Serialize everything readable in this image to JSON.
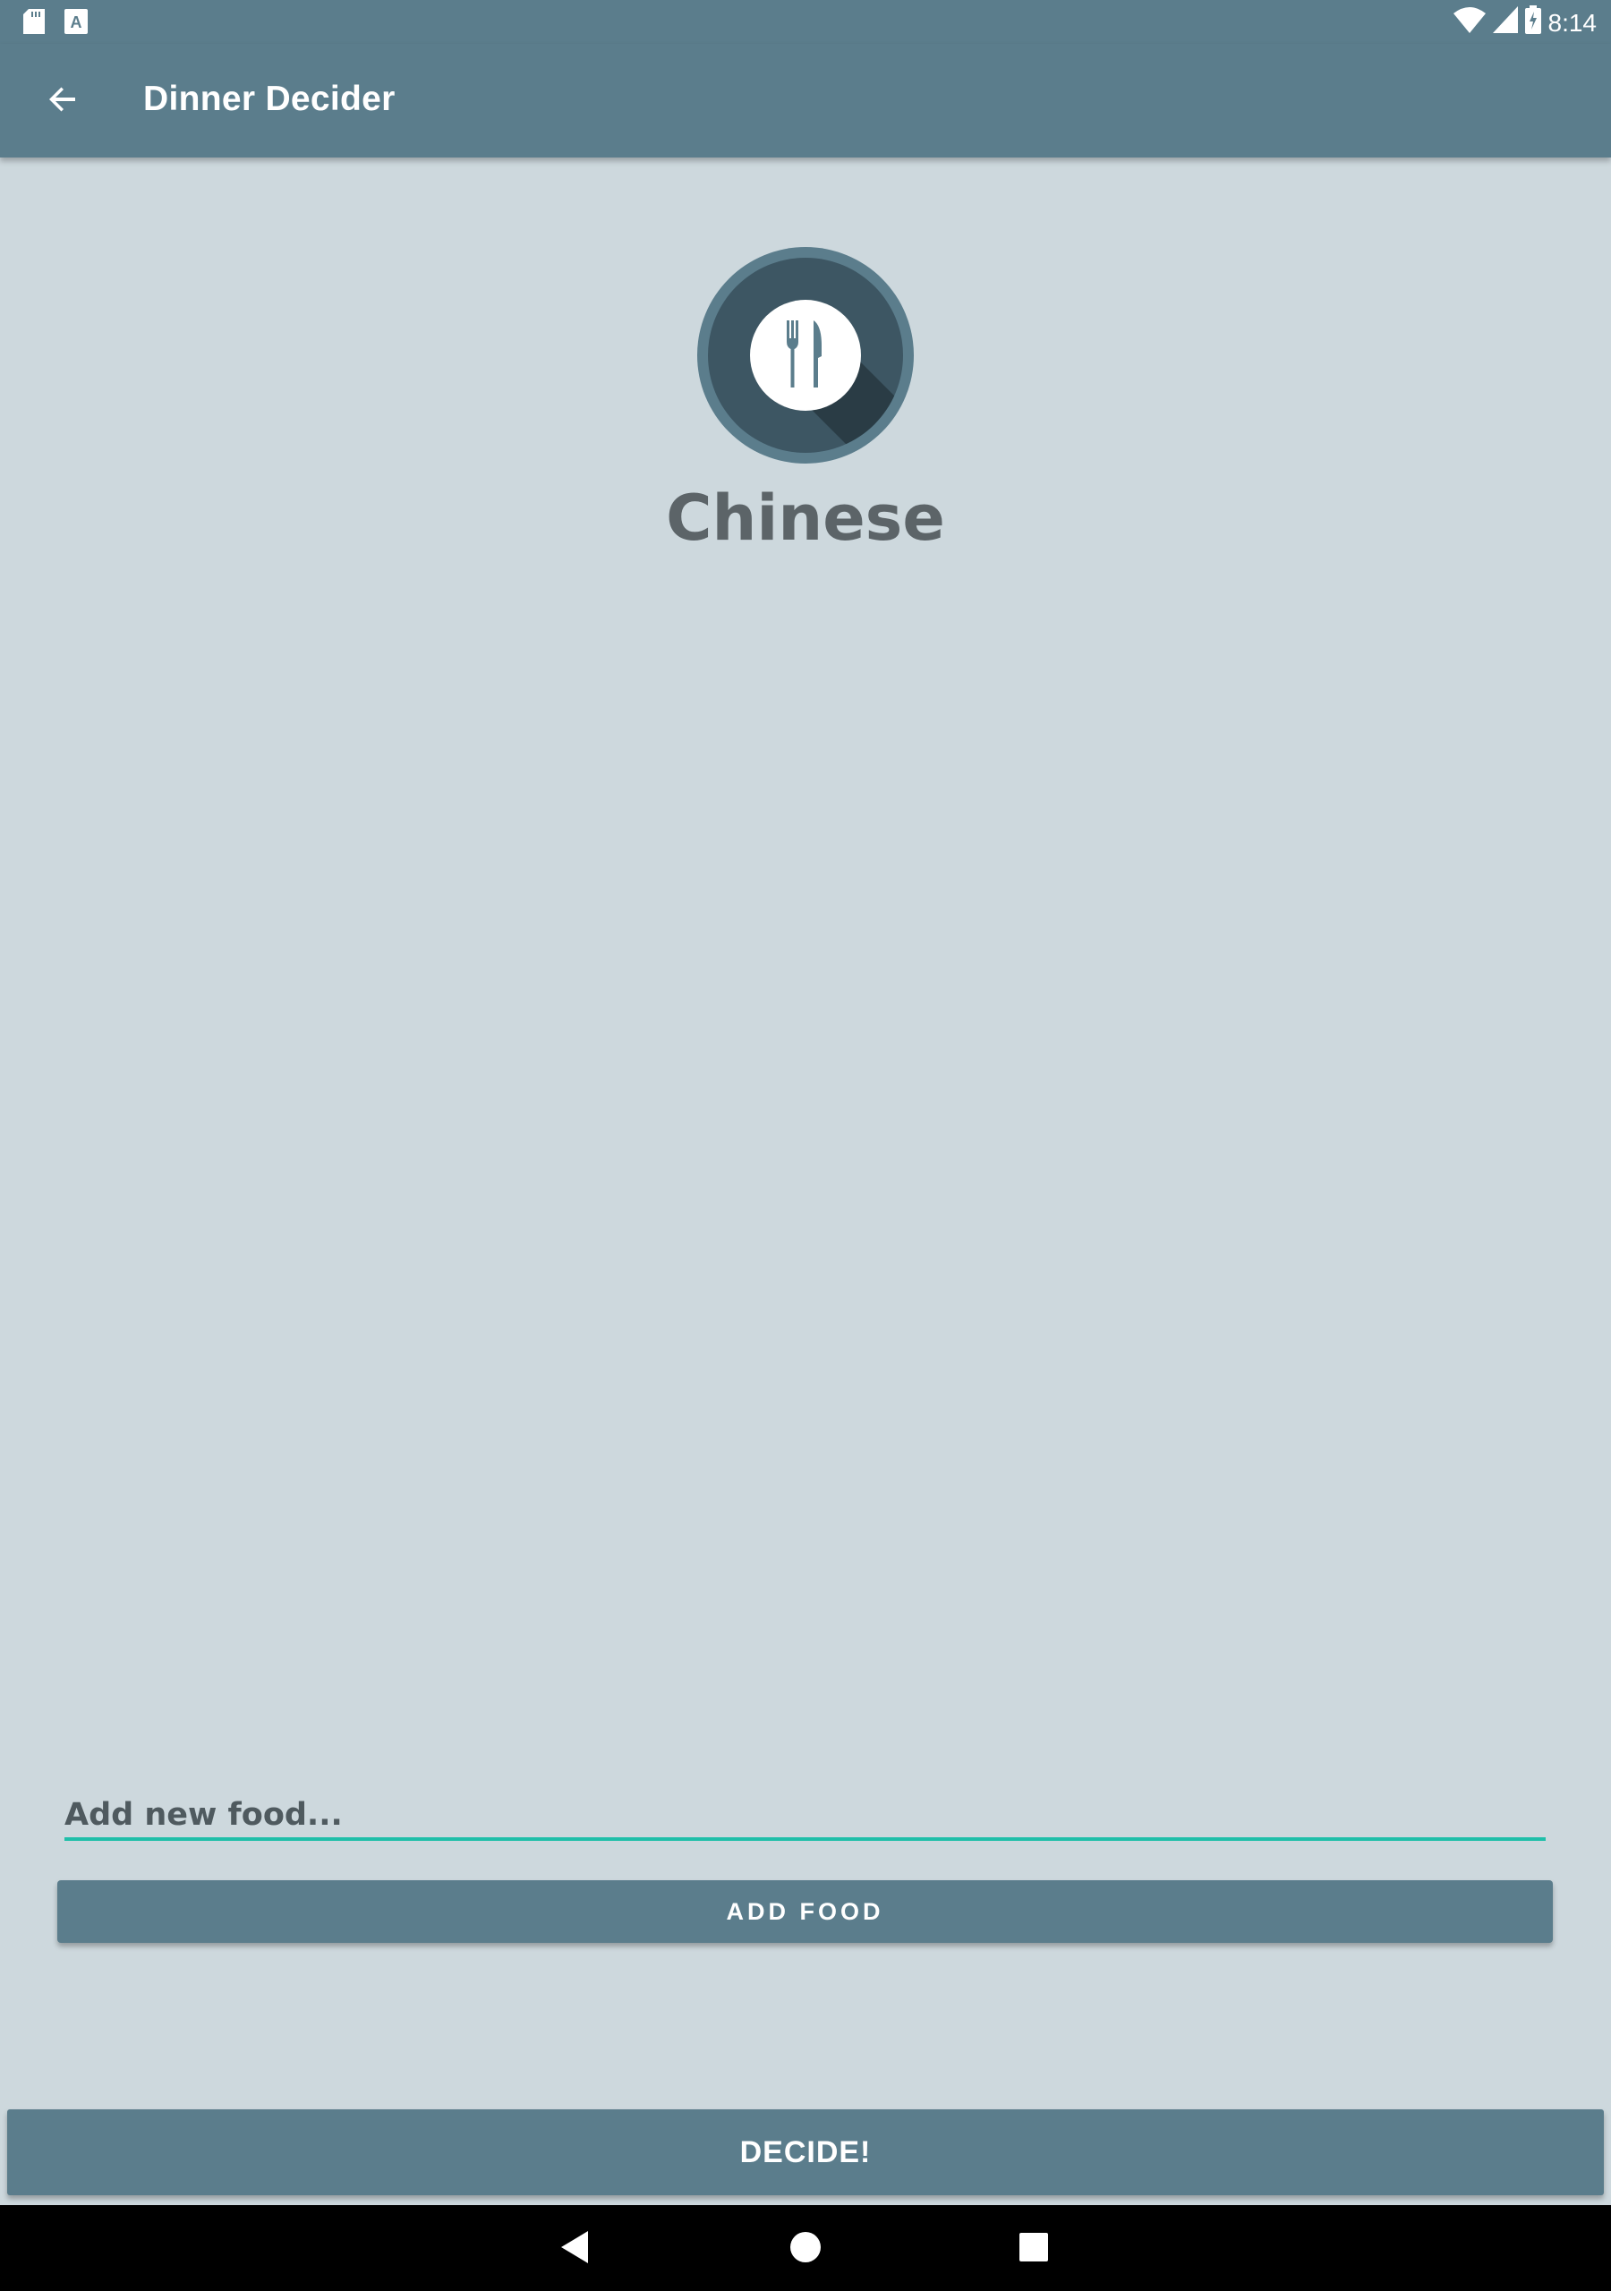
{
  "status_bar": {
    "time": "8:14",
    "icons": [
      "sd-card-icon",
      "keyboard-a-icon",
      "wifi-icon",
      "signal-icon",
      "battery-charging-icon"
    ]
  },
  "app_bar": {
    "title": "Dinner Decider",
    "back_icon": "arrow-back-icon"
  },
  "main": {
    "logo_icon": "fork-knife-icon",
    "selected_food": "Chinese"
  },
  "add_food": {
    "input_placeholder": "Add new food...",
    "input_value": "",
    "button_label": "ADD FOOD"
  },
  "decide": {
    "button_label": "DECIDE!"
  },
  "nav_bar": {
    "icons": [
      "nav-back-icon",
      "nav-home-icon",
      "nav-recents-icon"
    ]
  },
  "colors": {
    "primary": "#5b7d8c",
    "background": "#cdd8dd",
    "accent": "#1fbfa9",
    "logo_dark": "#3d5663"
  }
}
